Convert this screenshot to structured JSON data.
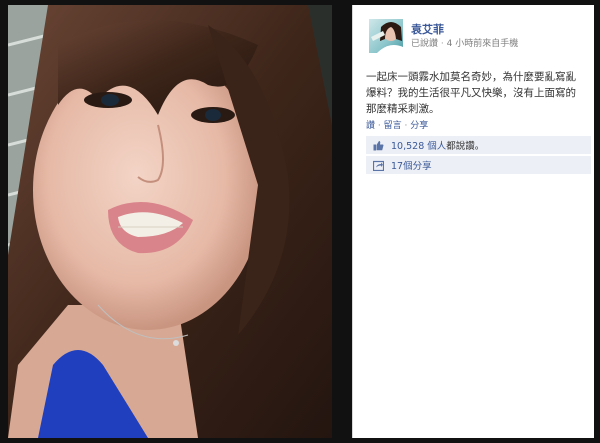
{
  "post": {
    "page_name": "袁艾菲",
    "like_label": "已說讚",
    "time_label": "4 小時前來自手機",
    "text": "一起床一頭霧水加莫名奇妙，為什麼要亂寫亂爆料？我的生活很平凡又快樂，沒有上面寫的那麼精采刺激。",
    "actions": {
      "like": "讚",
      "comment": "留言",
      "share": "分享"
    },
    "likes": {
      "count": "10,528 個人",
      "suffix": "都說讚。"
    },
    "shares": {
      "label": "17個分享"
    }
  },
  "colors": {
    "link": "#3b5998",
    "box_bg": "#eceff5",
    "frame": "#111111"
  }
}
